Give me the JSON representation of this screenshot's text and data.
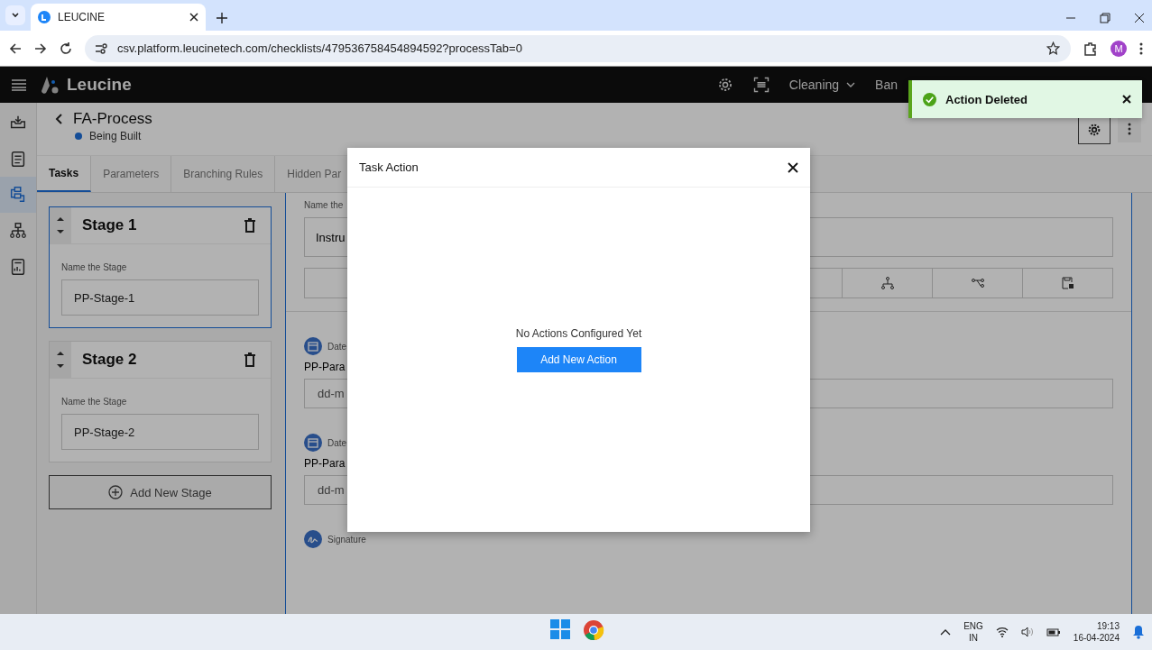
{
  "browser": {
    "tab_title": "LEUCINE",
    "url": "csv.platform.leucinetech.com/checklists/479536758454894592?processTab=0",
    "profile_initial": "M"
  },
  "app_header": {
    "brand": "Leucine",
    "items": [
      {
        "label": "Cleaning",
        "kind": "dropdown"
      },
      {
        "label": "Ban",
        "kind": "text"
      }
    ]
  },
  "sidebar": {
    "items": [
      {
        "selected": false
      },
      {
        "selected": false
      },
      {
        "selected": true
      },
      {
        "selected": false
      },
      {
        "selected": false
      }
    ]
  },
  "process": {
    "title": "FA-Process",
    "status": "Being Built"
  },
  "tabs": [
    {
      "label": "Tasks",
      "selected": true
    },
    {
      "label": "Parameters",
      "selected": false
    },
    {
      "label": "Branching Rules",
      "selected": false
    },
    {
      "label": "Hidden Par",
      "selected": false
    }
  ],
  "stages": [
    {
      "title": "Stage 1",
      "field_label": "Name the Stage",
      "value": "PP-Stage-1",
      "selected": true
    },
    {
      "title": "Stage 2",
      "field_label": "Name the Stage",
      "value": "PP-Stage-2",
      "selected": false
    }
  ],
  "add_stage_button": "Add New Stage",
  "task_panel": {
    "name_label": "Name the",
    "name_value": "Instru",
    "parameters": [
      {
        "kind": "date",
        "type_label": "Date",
        "name": "PP-Para",
        "value": "dd-m"
      },
      {
        "kind": "date",
        "type_label": "Date",
        "name": "PP-Para",
        "value": "dd-m"
      },
      {
        "kind": "signature",
        "type_label": "Signature"
      }
    ]
  },
  "modal": {
    "title": "Task Action",
    "empty_text": "No Actions Configured Yet",
    "button": "Add New Action"
  },
  "toast": {
    "message": "Action Deleted"
  },
  "taskbar": {
    "language": "ENG",
    "region": "IN",
    "time": "19:13",
    "date": "16-04-2024"
  }
}
